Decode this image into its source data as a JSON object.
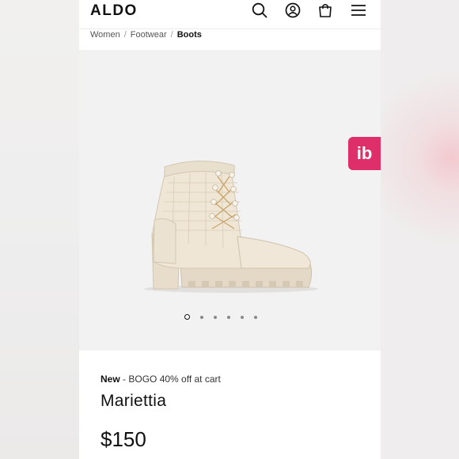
{
  "header": {
    "logo": "ALDO",
    "icons": [
      "search-icon",
      "account-icon",
      "bag-icon",
      "menu-icon"
    ]
  },
  "breadcrumb": {
    "items": [
      "Women",
      "Footwear"
    ],
    "current": "Boots",
    "separator": "/"
  },
  "gallery": {
    "badge": "ib",
    "badge_color": "#de2f6b",
    "slide_count": 6,
    "active_slide": 1
  },
  "product": {
    "promo_tag": "New",
    "promo_text": " - BOGO 40% off at cart",
    "name": "Mariettia",
    "price": "$150"
  }
}
